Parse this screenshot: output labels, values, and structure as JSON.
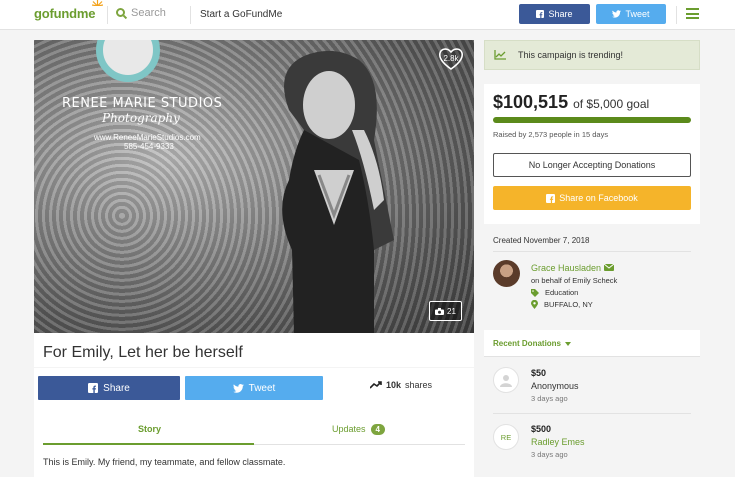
{
  "header": {
    "logo_pre": "go",
    "logo_post": "fundme",
    "search_placeholder": "Search",
    "start_label": "Start a GoFundMe",
    "share_label": "Share",
    "tweet_label": "Tweet"
  },
  "photo": {
    "studio_line1": "RENEE MARIE STUDIOS",
    "studio_line2": "Photography",
    "studio_line3": "www.ReneeMarieStudios.com",
    "studio_line4": "585-454-9333",
    "heart_count": "2.8k",
    "gallery_count": "21"
  },
  "campaign": {
    "title": "For Emily, Let her be herself",
    "share_label": "Share",
    "tweet_label": "Tweet",
    "shares_count": "10k",
    "shares_label": "shares"
  },
  "tabs": {
    "story": "Story",
    "updates": "Updates",
    "updates_count": "4"
  },
  "story_text": "This is Emily. My friend, my teammate, and fellow classmate.",
  "trending": "This campaign is trending!",
  "funding": {
    "raised": "$100,515",
    "goal": "of $5,000 goal",
    "progress": 1.0,
    "raised_by": "Raised by 2,573 people in 15 days",
    "no_longer": "No Longer Accepting Donations",
    "share_fb": "Share on Facebook"
  },
  "organizer": {
    "created": "Created November 7, 2018",
    "name": "Grace Hausladen",
    "behalf": "on behalf of Emily Scheck",
    "category": "Education",
    "location": "BUFFALO, NY"
  },
  "donations": {
    "header": "Recent Donations",
    "items": [
      {
        "amount": "$50",
        "name": "Anonymous",
        "time": "3 days ago",
        "initials": ""
      },
      {
        "amount": "$500",
        "name": "Radley Emes",
        "time": "3 days ago",
        "initials": "RE"
      }
    ]
  },
  "colors": {
    "brand_green": "#6b9d2f",
    "facebook": "#3b5998",
    "twitter": "#55acee",
    "share_yellow": "#f5b42a"
  }
}
